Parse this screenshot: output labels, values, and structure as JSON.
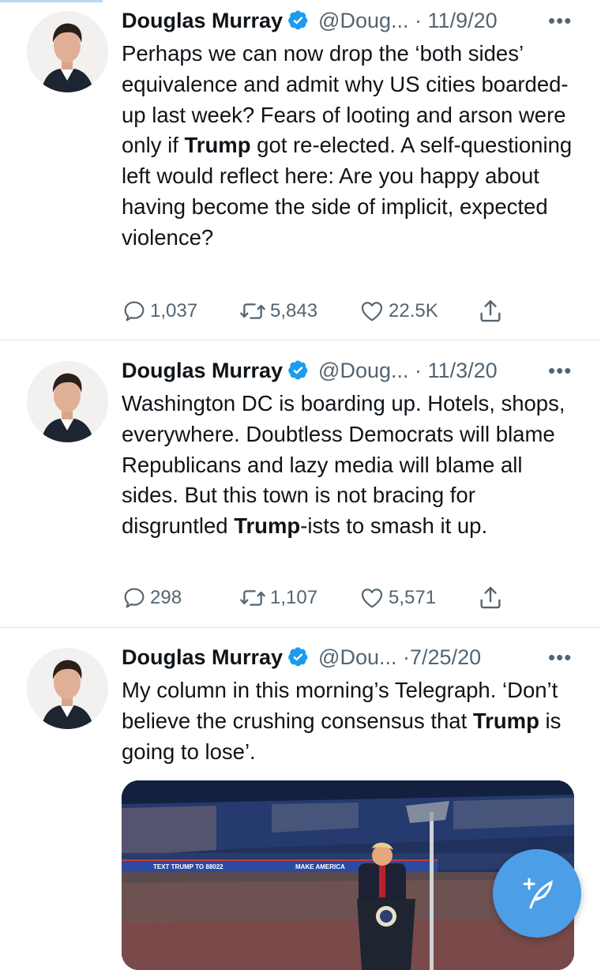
{
  "tweets": [
    {
      "name": "Douglas Murray",
      "handle": "@Doug...",
      "dot": "·",
      "date": "11/9/20",
      "more": "•••",
      "text_parts": [
        "Perhaps we can now drop the ‘both sides’ equivalence and admit why US cities boarded-up last week? Fears of looting and arson were only if ",
        "Trump",
        " got re-elected. A self-questioning left would reflect here: Are you happy about having become the side of implicit, expected violence?"
      ],
      "replies": "1,037",
      "retweets": "5,843",
      "likes": "22.5K"
    },
    {
      "name": "Douglas Murray",
      "handle": "@Doug...",
      "dot": "·",
      "date": "11/3/20",
      "more": "•••",
      "text_parts": [
        "Washington DC is boarding up. Hotels, shops, everywhere. Doubtless Democrats will blame Republicans and lazy media will blame all sides. But this town is not bracing for disgruntled ",
        "Trump",
        "-ists to smash it up."
      ],
      "replies": "298",
      "retweets": "1,107",
      "likes": "5,571"
    },
    {
      "name": "Douglas Murray",
      "handle": "@Dou...",
      "dot": "·",
      "date": "7/25/20",
      "more": "•••",
      "text_parts": [
        "My column in this morning’s Telegraph. ‘Don’t believe the crushing consensus that ",
        "Trump",
        " is going to lose’."
      ]
    }
  ],
  "card_image": {
    "banner_left": "TEXT TRUMP TO 88022",
    "banner_right": "MAKE AMERICA"
  },
  "colors": {
    "verified": "#1d9bf0",
    "muted_text": "#536471",
    "fab": "#4c9fe7",
    "divider": "#dcdfe3"
  },
  "icons": {
    "reply": "speech-bubble",
    "retweet": "two-arrows-loop",
    "like": "heart-outline",
    "share": "upload-arrow",
    "compose": "feather-plus"
  }
}
